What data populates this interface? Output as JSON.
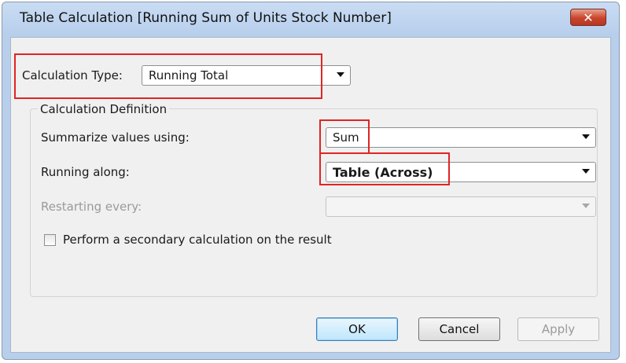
{
  "window": {
    "title": "Table Calculation [Running Sum of Units Stock Number]",
    "close_glyph": "✕"
  },
  "calculation_type": {
    "label": "Calculation Type:",
    "value": "Running Total"
  },
  "definition": {
    "legend": "Calculation Definition",
    "summarize": {
      "label": "Summarize values using:",
      "value": "Sum"
    },
    "running_along": {
      "label": "Running along:",
      "value": "Table (Across)"
    },
    "restarting": {
      "label": "Restarting every:",
      "value": ""
    },
    "secondary": {
      "label": "Perform a secondary calculation on the result",
      "checked": false
    }
  },
  "buttons": {
    "ok": "OK",
    "cancel": "Cancel",
    "apply": "Apply"
  },
  "colors": {
    "highlight": "#e02424",
    "title_bar": "#b8cfec",
    "dialog_bg": "#f0f0f0"
  }
}
